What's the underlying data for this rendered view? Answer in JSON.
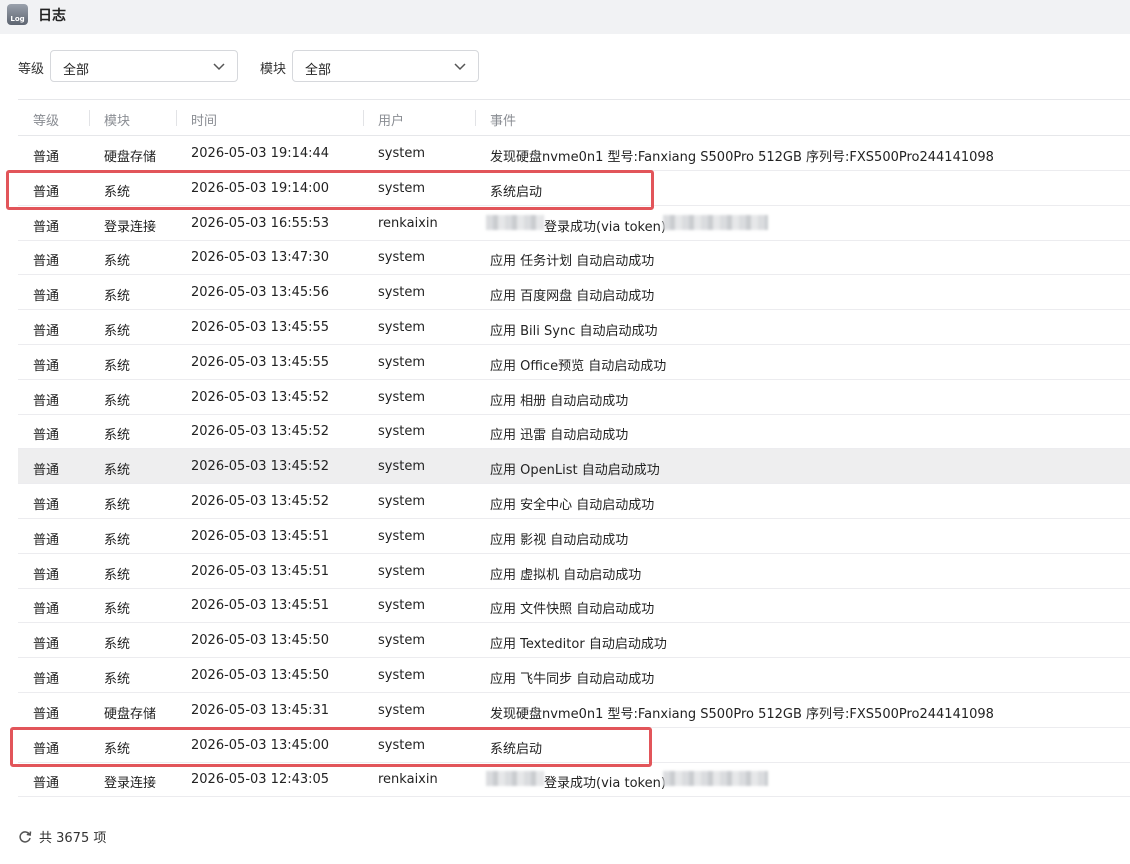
{
  "window": {
    "app_icon_text": "Log",
    "title": "日志"
  },
  "filters": {
    "level": {
      "label": "等级",
      "value": "全部"
    },
    "module": {
      "label": "模块",
      "value": "全部"
    }
  },
  "table": {
    "columns": [
      "等级",
      "模块",
      "时间",
      "用户",
      "事件"
    ],
    "rows": [
      {
        "level": "普通",
        "module": "硬盘存储",
        "time": "2026-05-03 19:14:44",
        "user": "system",
        "event": "发现硬盘nvme0n1 型号:Fanxiang S500Pro 512GB 序列号:FXS500Pro244141098"
      },
      {
        "level": "普通",
        "module": "系统",
        "time": "2026-05-03 19:14:00",
        "user": "system",
        "event": "系统启动"
      },
      {
        "level": "普通",
        "module": "登录连接",
        "time": "2026-05-03 16:55:53",
        "user": "renkaixin",
        "event": "登录成功(via token)"
      },
      {
        "level": "普通",
        "module": "系统",
        "time": "2026-05-03 13:47:30",
        "user": "system",
        "event": "应用 任务计划 自动启动成功"
      },
      {
        "level": "普通",
        "module": "系统",
        "time": "2026-05-03 13:45:56",
        "user": "system",
        "event": "应用 百度网盘 自动启动成功"
      },
      {
        "level": "普通",
        "module": "系统",
        "time": "2026-05-03 13:45:55",
        "user": "system",
        "event": "应用 Bili Sync 自动启动成功"
      },
      {
        "level": "普通",
        "module": "系统",
        "time": "2026-05-03 13:45:55",
        "user": "system",
        "event": "应用 Office预览 自动启动成功"
      },
      {
        "level": "普通",
        "module": "系统",
        "time": "2026-05-03 13:45:52",
        "user": "system",
        "event": "应用 相册 自动启动成功"
      },
      {
        "level": "普通",
        "module": "系统",
        "time": "2026-05-03 13:45:52",
        "user": "system",
        "event": "应用 迅雷 自动启动成功"
      },
      {
        "level": "普通",
        "module": "系统",
        "time": "2026-05-03 13:45:52",
        "user": "system",
        "event": "应用 OpenList 自动启动成功"
      },
      {
        "level": "普通",
        "module": "系统",
        "time": "2026-05-03 13:45:52",
        "user": "system",
        "event": "应用 安全中心 自动启动成功"
      },
      {
        "level": "普通",
        "module": "系统",
        "time": "2026-05-03 13:45:51",
        "user": "system",
        "event": "应用 影视 自动启动成功"
      },
      {
        "level": "普通",
        "module": "系统",
        "time": "2026-05-03 13:45:51",
        "user": "system",
        "event": "应用 虚拟机 自动启动成功"
      },
      {
        "level": "普通",
        "module": "系统",
        "time": "2026-05-03 13:45:51",
        "user": "system",
        "event": "应用 文件快照 自动启动成功"
      },
      {
        "level": "普通",
        "module": "系统",
        "time": "2026-05-03 13:45:50",
        "user": "system",
        "event": "应用 Texteditor 自动启动成功"
      },
      {
        "level": "普通",
        "module": "系统",
        "time": "2026-05-03 13:45:50",
        "user": "system",
        "event": "应用 飞牛同步 自动启动成功"
      },
      {
        "level": "普通",
        "module": "硬盘存储",
        "time": "2026-05-03 13:45:31",
        "user": "system",
        "event": "发现硬盘nvme0n1 型号:Fanxiang S500Pro 512GB 序列号:FXS500Pro244141098"
      },
      {
        "level": "普通",
        "module": "系统",
        "time": "2026-05-03 13:45:00",
        "user": "system",
        "event": "系统启动"
      },
      {
        "level": "普通",
        "module": "登录连接",
        "time": "2026-05-03 12:43:05",
        "user": "renkaixin",
        "event": "登录成功(via token)"
      }
    ]
  },
  "footer": {
    "total_text": "共 3675 项"
  },
  "colors": {
    "highlight_box": "#e2555a",
    "hover_row": "#eeeeef"
  }
}
